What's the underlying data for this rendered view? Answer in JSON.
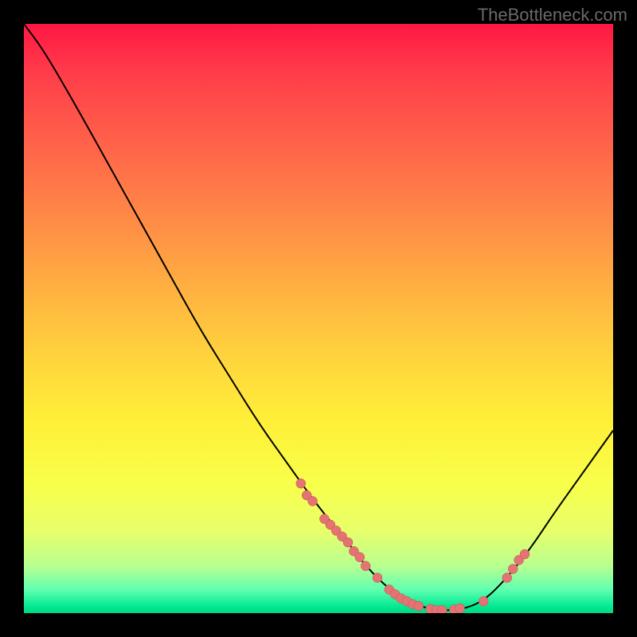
{
  "watermark": "TheBottleneck.com",
  "chart_data": {
    "type": "line",
    "title": "",
    "xlabel": "",
    "ylabel": "",
    "xlim": [
      0,
      100
    ],
    "ylim": [
      0,
      100
    ],
    "curve": {
      "points": [
        {
          "x": 0,
          "y": 100
        },
        {
          "x": 3,
          "y": 96
        },
        {
          "x": 6,
          "y": 91
        },
        {
          "x": 10,
          "y": 84
        },
        {
          "x": 15,
          "y": 75
        },
        {
          "x": 20,
          "y": 66
        },
        {
          "x": 25,
          "y": 57
        },
        {
          "x": 30,
          "y": 48
        },
        {
          "x": 35,
          "y": 40
        },
        {
          "x": 40,
          "y": 32
        },
        {
          "x": 45,
          "y": 25
        },
        {
          "x": 50,
          "y": 18
        },
        {
          "x": 55,
          "y": 12
        },
        {
          "x": 58,
          "y": 8
        },
        {
          "x": 62,
          "y": 4
        },
        {
          "x": 66,
          "y": 1.5
        },
        {
          "x": 70,
          "y": 0.5
        },
        {
          "x": 74,
          "y": 0.5
        },
        {
          "x": 78,
          "y": 2
        },
        {
          "x": 82,
          "y": 6
        },
        {
          "x": 86,
          "y": 11
        },
        {
          "x": 90,
          "y": 17
        },
        {
          "x": 95,
          "y": 24
        },
        {
          "x": 100,
          "y": 31
        }
      ]
    },
    "markers": [
      {
        "x": 47,
        "y": 22
      },
      {
        "x": 48,
        "y": 20
      },
      {
        "x": 49,
        "y": 19
      },
      {
        "x": 51,
        "y": 16
      },
      {
        "x": 52,
        "y": 15
      },
      {
        "x": 53,
        "y": 14
      },
      {
        "x": 54,
        "y": 13
      },
      {
        "x": 55,
        "y": 12
      },
      {
        "x": 56,
        "y": 10.5
      },
      {
        "x": 57,
        "y": 9.5
      },
      {
        "x": 58,
        "y": 8
      },
      {
        "x": 60,
        "y": 6
      },
      {
        "x": 62,
        "y": 4
      },
      {
        "x": 63,
        "y": 3.2
      },
      {
        "x": 64,
        "y": 2.5
      },
      {
        "x": 65,
        "y": 2
      },
      {
        "x": 66,
        "y": 1.5
      },
      {
        "x": 67,
        "y": 1.2
      },
      {
        "x": 69,
        "y": 0.7
      },
      {
        "x": 70,
        "y": 0.5
      },
      {
        "x": 71,
        "y": 0.5
      },
      {
        "x": 73,
        "y": 0.6
      },
      {
        "x": 74,
        "y": 0.8
      },
      {
        "x": 78,
        "y": 2
      },
      {
        "x": 82,
        "y": 6
      },
      {
        "x": 83,
        "y": 7.5
      },
      {
        "x": 84,
        "y": 9
      },
      {
        "x": 85,
        "y": 10
      }
    ]
  },
  "colors": {
    "curve_stroke": "#000000",
    "marker_fill": "#e57373",
    "marker_stroke": "#c05050"
  }
}
